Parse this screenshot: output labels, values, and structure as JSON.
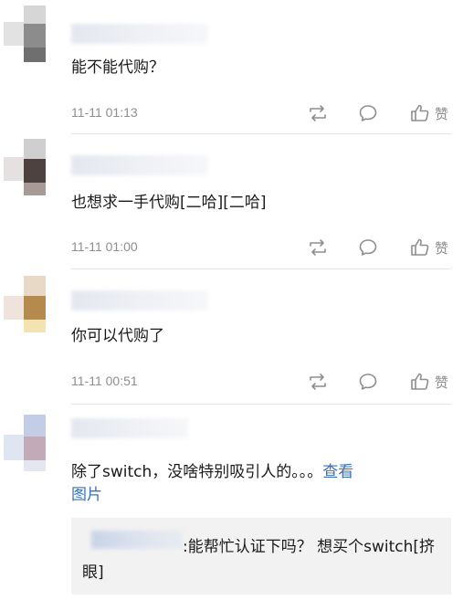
{
  "comments": [
    {
      "text": "能不能代购？",
      "timestamp": "11-11 01:13",
      "like_label": "赞",
      "avatar_colors": [
        "#9a9a9a",
        "#6f6f6f",
        "#c9c9c9"
      ]
    },
    {
      "text": "也想求一手代购[二哈][二哈]",
      "timestamp": "11-11 01:00",
      "like_label": "赞",
      "avatar_colors": [
        "#bdbdbd",
        "#4e4240",
        "#a79a97"
      ]
    },
    {
      "text": "你可以代购了",
      "timestamp": "11-11 00:51",
      "like_label": "赞",
      "avatar_colors": [
        "#e8d9c6",
        "#b58a4d",
        "#f3e3b0"
      ]
    },
    {
      "text_main": "除了switch，没啥特别吸引人的。。。",
      "link_text_1": "查看",
      "link_text_2": "图片",
      "avatar_colors": [
        "#c3cee6",
        "#c2aab8",
        "#e3e7f0"
      ],
      "reply": {
        "text": ":能帮忙认证下吗？ 想买个switch[挤眼]"
      }
    }
  ],
  "colors": {
    "link": "#3a70b4",
    "meta_gray": "#8e8e8e",
    "reply_bg": "#f2f2f2"
  }
}
